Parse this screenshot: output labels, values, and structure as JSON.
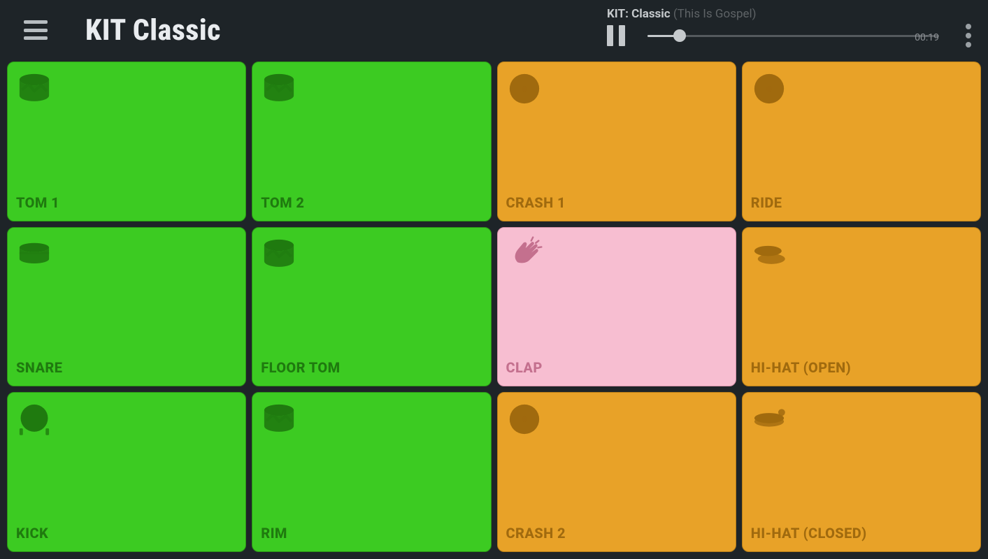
{
  "header": {
    "title": "KIT Classic"
  },
  "player": {
    "kit_prefix": "KIT:",
    "kit_name": "Classic",
    "song_name": "(This Is Gospel)",
    "time": "00:19",
    "progress_pct": 11
  },
  "colors": {
    "green": "#3ccb22",
    "orange": "#e8a228",
    "pink": "#f7bed1",
    "bg": "#1e2428"
  },
  "pads": [
    {
      "label": "TOM 1",
      "color": "green",
      "icon": "tom"
    },
    {
      "label": "TOM 2",
      "color": "green",
      "icon": "tom"
    },
    {
      "label": "CRASH 1",
      "color": "orange",
      "icon": "cymbal"
    },
    {
      "label": "RIDE",
      "color": "orange",
      "icon": "cymbal"
    },
    {
      "label": "SNARE",
      "color": "green",
      "icon": "snare"
    },
    {
      "label": "FLOOR  TOM",
      "color": "green",
      "icon": "tom"
    },
    {
      "label": "CLAP",
      "color": "pink",
      "icon": "clap"
    },
    {
      "label": "HI-HAT (OPEN)",
      "color": "orange",
      "icon": "hihat-open"
    },
    {
      "label": "KICK",
      "color": "green",
      "icon": "kick"
    },
    {
      "label": "RIM",
      "color": "green",
      "icon": "tom"
    },
    {
      "label": "CRASH 2",
      "color": "orange",
      "icon": "cymbal"
    },
    {
      "label": "HI-HAT (CLOSED)",
      "color": "orange",
      "icon": "hihat-closed"
    }
  ]
}
